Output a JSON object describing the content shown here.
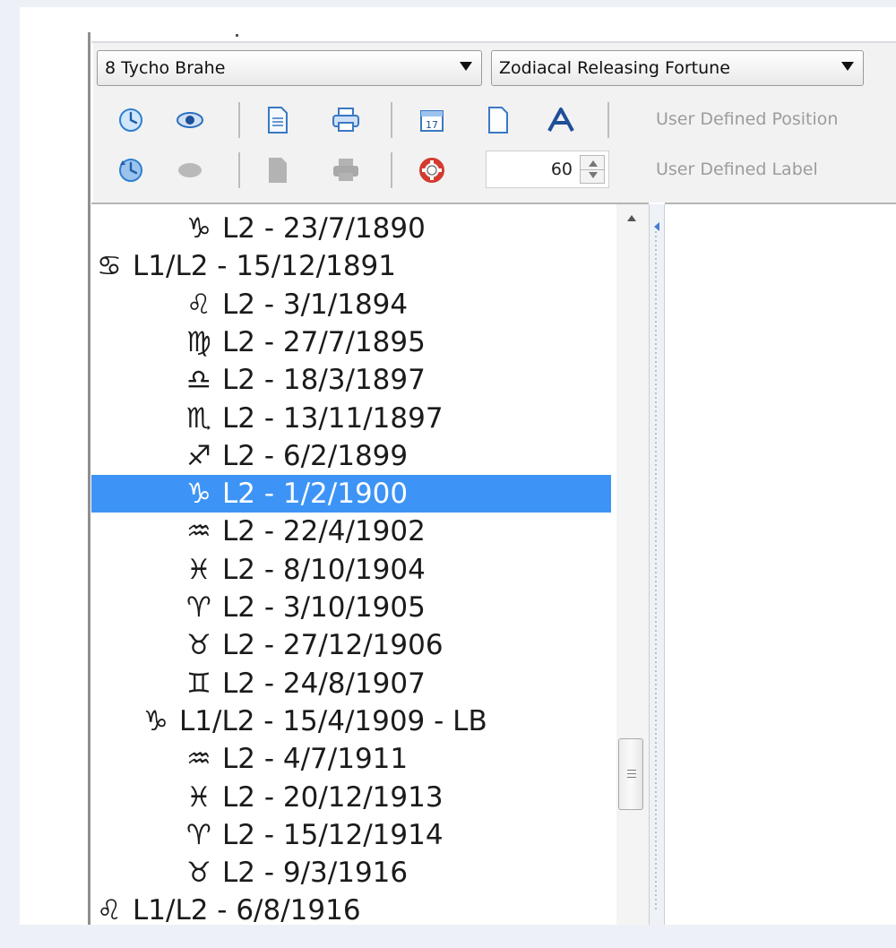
{
  "toolbar": {
    "chart_select": "8 Tycho Brahe",
    "technique_select": "Zodiacal Releasing Fortune",
    "spin_value": "60",
    "user_defined_position": "User Defined Position",
    "user_defined_label": "User Defined Label",
    "icons": {
      "row1": [
        "clock-icon",
        "eye-icon",
        "document-icon",
        "printer-icon",
        "calendar-icon",
        "blank-page-icon",
        "font-icon"
      ],
      "row2": [
        "clock-arrow-icon",
        "eye-disabled-icon",
        "document-disabled-icon",
        "printer-disabled-icon",
        "lifebuoy-icon"
      ]
    }
  },
  "list": {
    "rows": [
      {
        "glyph": "♑",
        "text": "L2 - 23/7/1890",
        "indent": 2
      },
      {
        "glyph": "♋",
        "text": "L1/L2 - 15/12/1891",
        "indent": 0
      },
      {
        "glyph": "♌",
        "text": "L2 - 3/1/1894",
        "indent": 2
      },
      {
        "glyph": "♍",
        "text": "L2 - 27/7/1895",
        "indent": 2
      },
      {
        "glyph": "♎",
        "text": "L2 - 18/3/1897",
        "indent": 2
      },
      {
        "glyph": "♏",
        "text": "L2 - 13/11/1897",
        "indent": 2
      },
      {
        "glyph": "♐",
        "text": "L2 - 6/2/1899",
        "indent": 2
      },
      {
        "glyph": "♑",
        "text": "L2 - 1/2/1900",
        "indent": 2,
        "selected": true
      },
      {
        "glyph": "♒",
        "text": "L2 - 22/4/1902",
        "indent": 2
      },
      {
        "glyph": "♓",
        "text": "L2 - 8/10/1904",
        "indent": 2
      },
      {
        "glyph": "♈",
        "text": "L2 - 3/10/1905",
        "indent": 2
      },
      {
        "glyph": "♉",
        "text": "L2 - 27/12/1906",
        "indent": 2
      },
      {
        "glyph": "♊",
        "text": "L2 - 24/8/1907",
        "indent": 2
      },
      {
        "glyph": "♑",
        "text": "L1/L2 - 15/4/1909 - LB",
        "indent": 1
      },
      {
        "glyph": "♒",
        "text": "L2 - 4/7/1911",
        "indent": 2
      },
      {
        "glyph": "♓",
        "text": "L2 - 20/12/1913",
        "indent": 2
      },
      {
        "glyph": "♈",
        "text": "L2 - 15/12/1914",
        "indent": 2
      },
      {
        "glyph": "♉",
        "text": "L2 - 9/3/1916",
        "indent": 2
      },
      {
        "glyph": "♌",
        "text": "L1/L2 - 6/8/1916",
        "indent": 0
      }
    ]
  },
  "colors": {
    "selection": "#3d94f6",
    "toolbar_bg": "#f2f2f2",
    "disabled_text": "#9c9c9c"
  }
}
